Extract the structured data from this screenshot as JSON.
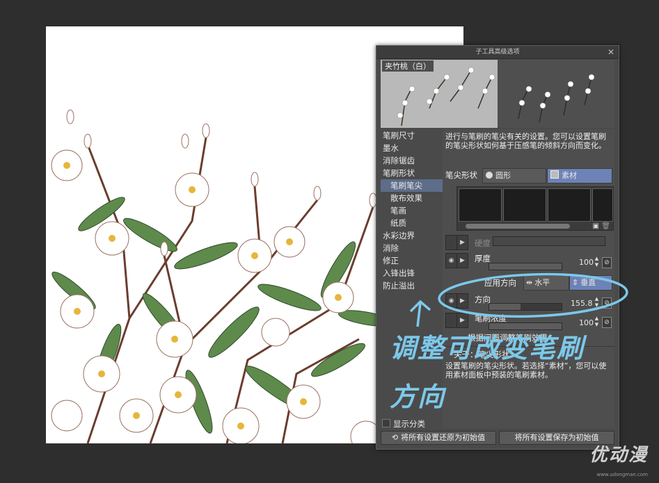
{
  "dialog": {
    "title": "子工具高级选项",
    "brush_name": "夹竹桃（白）",
    "categories": [
      "笔刷尺寸",
      "墨水",
      "消除锯齿",
      "笔刷形状",
      "笔刷笔尖",
      "散布效果",
      "笔画",
      "纸质",
      "水彩边界",
      "消除",
      "修正",
      "入锋出锋",
      "防止溢出"
    ],
    "description": "进行与笔刷的笔尖有关的设置。您可以设置笔刷的笔尖形状如何基于压感笔的倾斜方向而变化。",
    "tip_shape_label": "笔尖形状",
    "tip_shape_options": [
      "圆形",
      "素材"
    ],
    "hardness_label": "硬度",
    "thickness_label": "厚度",
    "thickness_value": "100",
    "apply_direction_label": "应用方向",
    "apply_direction_options": [
      "水平",
      "垂直"
    ],
    "direction_label": "方向",
    "direction_value": "155.8",
    "density_label": "笔刷浓度",
    "density_value": "100",
    "interval_label": "根据间隔调整笔刷效果",
    "about_label": "关于：笔尖形状",
    "about_text": "设置笔刷的笔尖形状。若选择“素材”，您可以使用素材面板中预装的笔刷素材。",
    "show_category_label": "显示分类",
    "reset_button_label": "将所有设置还原为初始值",
    "save_button_label": "将所有设置保存为初始值"
  },
  "annotation": {
    "line1": "调整可改变笔刷",
    "line2": "方向",
    "color": "#7cc8ea"
  },
  "watermark": {
    "logo_text": "优动漫",
    "url": "www.udongman.com"
  },
  "colors": {
    "selected_category": "#5d6d8a",
    "selected_segment": "#6d82b6",
    "leaf_green": "#5e8a4c"
  }
}
